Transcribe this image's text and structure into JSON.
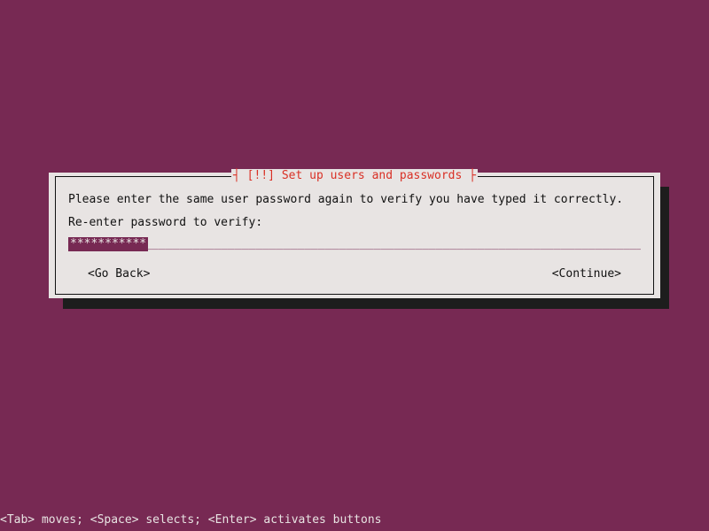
{
  "dialog": {
    "title": "┤ [!!] Set up users and passwords ├",
    "message": "Please enter the same user password again to verify you have typed it correctly.",
    "field_label": "Re-enter password to verify:",
    "password_masked": "***********",
    "underscores": "________________________________________________________________________________________________________________________",
    "go_back": "<Go Back>",
    "continue": "<Continue>"
  },
  "helpbar": "<Tab> moves; <Space> selects; <Enter> activates buttons"
}
